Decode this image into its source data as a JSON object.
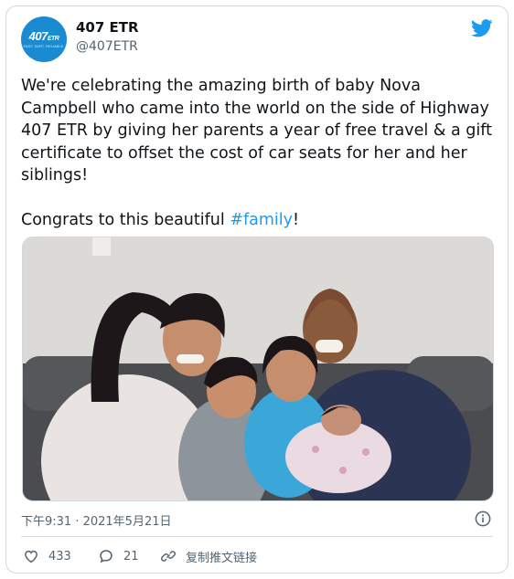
{
  "author": {
    "avatar_text": "407",
    "avatar_subtext": "ETR",
    "avatar_tagline": "FAST. SAFE. RELIABLE.",
    "display_name": "407 ETR",
    "handle": "@407ETR"
  },
  "tweet": {
    "text_main": "We're celebrating the amazing birth of baby Nova Campbell who came into the world on the side of Highway 407 ETR by giving her parents a year of free travel & a gift certificate to offset the cost of car seats for her and her siblings!\n\nCongrats to this beautiful ",
    "hashtag": "#family",
    "text_end": "!",
    "timestamp": "下午9:31 · 2021年5月21日"
  },
  "actions": {
    "like_count": "433",
    "reply_count": "21",
    "copy_link_label": "复制推文链接"
  },
  "colors": {
    "accent": "#1d9bf0",
    "avatar_bg": "#1a8bd0",
    "muted_text": "#536471",
    "border": "#cfd9de"
  },
  "icons": {
    "brand": "twitter-bird-icon",
    "info": "info-icon",
    "like": "heart-icon",
    "reply": "reply-bubble-icon",
    "copy": "link-icon"
  }
}
